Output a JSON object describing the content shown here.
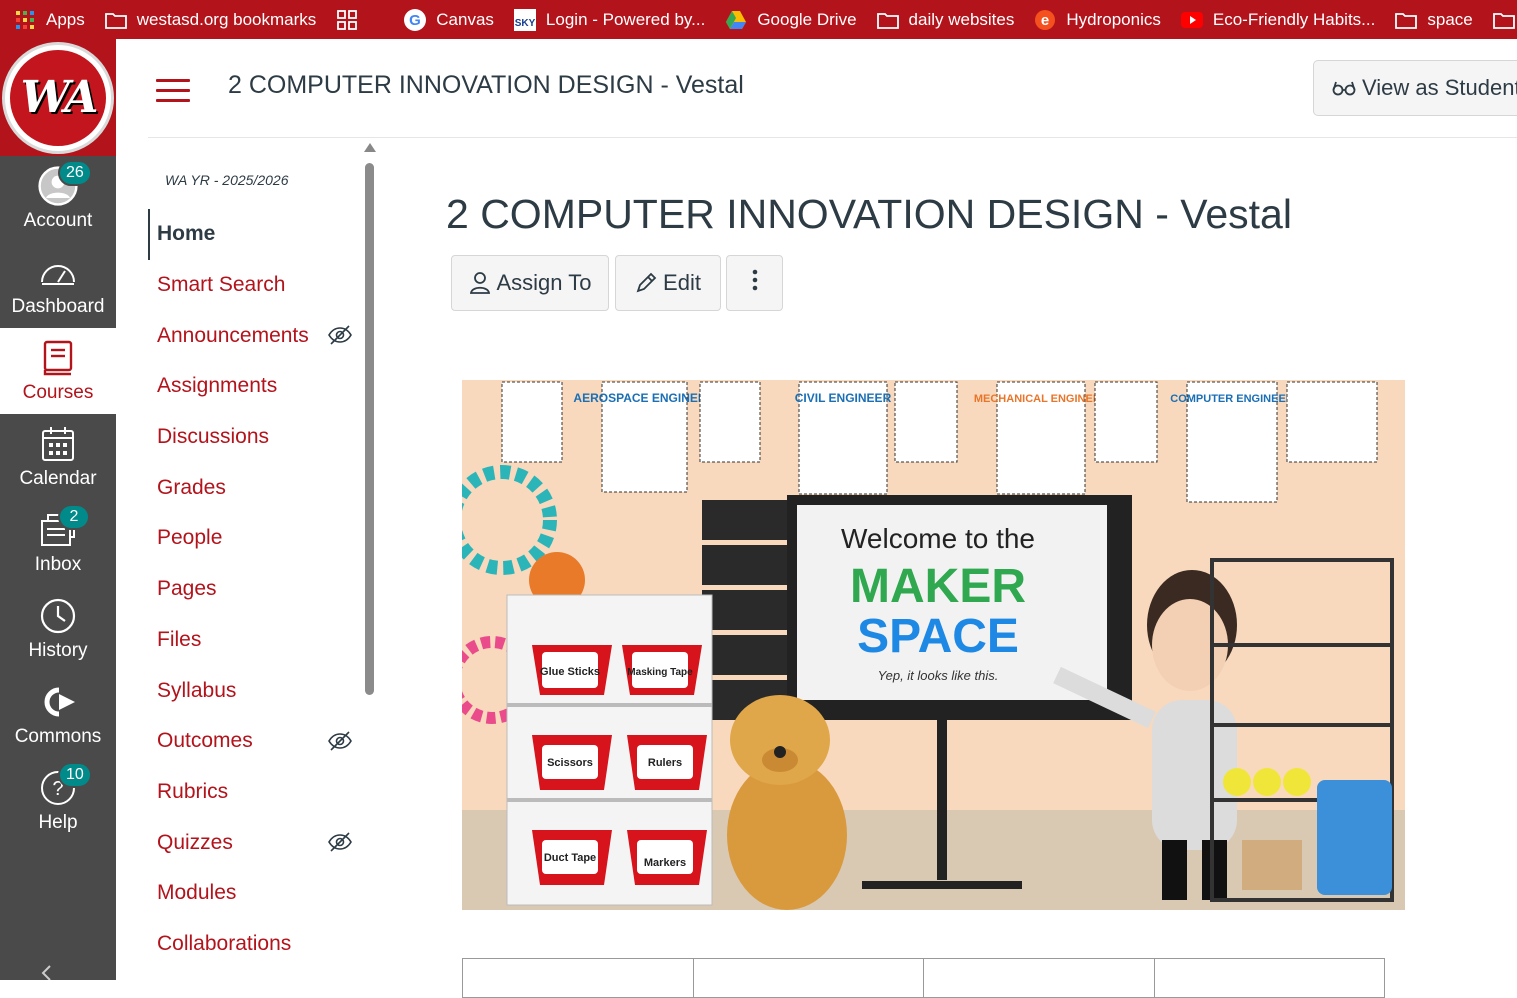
{
  "bookmarks": [
    {
      "label": "Apps",
      "icon": "apps-grid-icon"
    },
    {
      "label": "westasd.org bookmarks",
      "icon": "folder-icon"
    },
    {
      "label": "",
      "icon": "tab-groups-icon"
    },
    {
      "label": "Canvas",
      "icon": "google-icon"
    },
    {
      "label": "Login - Powered by...",
      "icon": "sky-icon"
    },
    {
      "label": "Google Drive",
      "icon": "google-drive-icon"
    },
    {
      "label": "daily websites",
      "icon": "folder-icon"
    },
    {
      "label": "Hydroponics",
      "icon": "edge-e-icon"
    },
    {
      "label": "Eco-Friendly Habits...",
      "icon": "youtube-icon"
    },
    {
      "label": "space",
      "icon": "folder-icon"
    },
    {
      "label": "",
      "icon": "folder-icon"
    }
  ],
  "global_nav": {
    "logo_text": "WA",
    "items": [
      {
        "label": "Account",
        "icon": "account-avatar-icon",
        "badge": "26",
        "active": false
      },
      {
        "label": "Dashboard",
        "icon": "dashboard-gauge-icon",
        "badge": "",
        "active": false
      },
      {
        "label": "Courses",
        "icon": "courses-book-icon",
        "badge": "",
        "active": true
      },
      {
        "label": "Calendar",
        "icon": "calendar-icon",
        "badge": "",
        "active": false
      },
      {
        "label": "Inbox",
        "icon": "inbox-icon",
        "badge": "2",
        "active": false
      },
      {
        "label": "History",
        "icon": "history-clock-icon",
        "badge": "",
        "active": false
      },
      {
        "label": "Commons",
        "icon": "commons-icon",
        "badge": "",
        "active": false
      },
      {
        "label": "Help",
        "icon": "help-icon",
        "badge": "10",
        "active": false
      }
    ]
  },
  "header": {
    "breadcrumb": "2 COMPUTER INNOVATION DESIGN - Vestal",
    "view_as_student": "View as Student"
  },
  "course_nav": {
    "term": "WA YR - 2025/2026",
    "items": [
      {
        "label": "Home",
        "active": true,
        "hidden": false
      },
      {
        "label": "Smart Search",
        "active": false,
        "hidden": false
      },
      {
        "label": "Announcements",
        "active": false,
        "hidden": true
      },
      {
        "label": "Assignments",
        "active": false,
        "hidden": false
      },
      {
        "label": "Discussions",
        "active": false,
        "hidden": false
      },
      {
        "label": "Grades",
        "active": false,
        "hidden": false
      },
      {
        "label": "People",
        "active": false,
        "hidden": false
      },
      {
        "label": "Pages",
        "active": false,
        "hidden": false
      },
      {
        "label": "Files",
        "active": false,
        "hidden": false
      },
      {
        "label": "Syllabus",
        "active": false,
        "hidden": false
      },
      {
        "label": "Outcomes",
        "active": false,
        "hidden": true
      },
      {
        "label": "Rubrics",
        "active": false,
        "hidden": false
      },
      {
        "label": "Quizzes",
        "active": false,
        "hidden": true
      },
      {
        "label": "Modules",
        "active": false,
        "hidden": false
      },
      {
        "label": "Collaborations",
        "active": false,
        "hidden": false
      }
    ]
  },
  "main": {
    "title": "2 COMPUTER INNOVATION DESIGN - Vestal",
    "assign_to": "Assign To",
    "edit": "Edit",
    "banner": {
      "posters": [
        "AEROSPACE ENGINEER",
        "CIVIL ENGINEER",
        "MECHANICAL ENGINEER",
        "COMPUTER ENGINEER"
      ],
      "welcome": "Welcome to the",
      "maker": "MAKER",
      "space": "SPACE",
      "tagline": "Yep, it looks like this.",
      "bins": [
        "Glue Sticks",
        "Masking Tape",
        "Scissors",
        "Rulers",
        "Duct Tape",
        "Markers"
      ]
    }
  },
  "colors": {
    "brand_red": "#b3131b",
    "nav_gray": "#4a4a4a",
    "badge_teal": "#008a8a",
    "text_dark": "#2d3b45"
  }
}
